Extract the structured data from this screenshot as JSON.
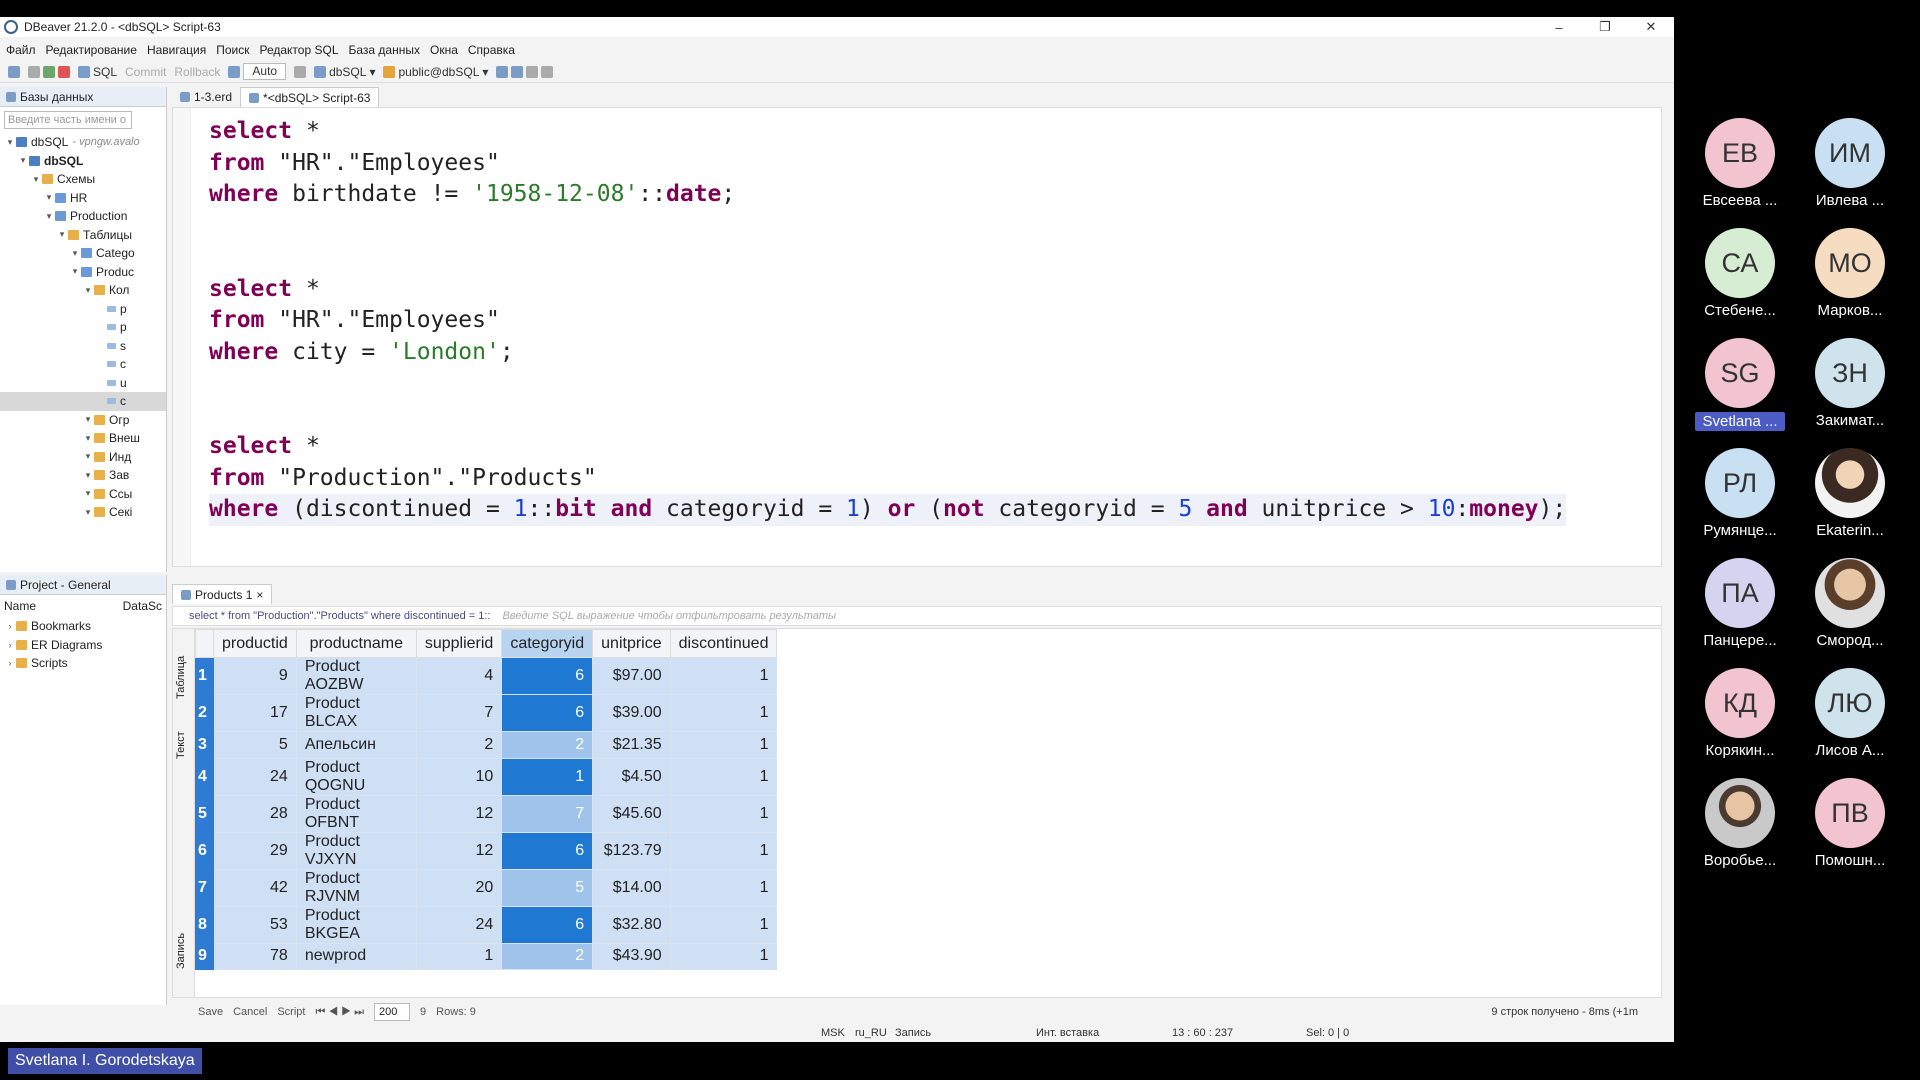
{
  "window": {
    "title": "DBeaver 21.2.0 - <dbSQL> Script-63"
  },
  "menu": [
    "Файл",
    "Редактирование",
    "Навигация",
    "Поиск",
    "Редактор SQL",
    "База данных",
    "Окна",
    "Справка"
  ],
  "toolbar": {
    "sql": "SQL",
    "commit": "Commit",
    "rollback": "Rollback",
    "mode": "Auto",
    "datasource": "dbSQL",
    "schema": "public@dbSQL"
  },
  "db_panel": {
    "title": "Базы данных",
    "filter_placeholder": "Введите часть имени о",
    "tree": [
      {
        "label": "dbSQL",
        "sub": "- vpngw.avalo",
        "level": 0,
        "type": "db"
      },
      {
        "label": "dbSQL",
        "level": 1,
        "type": "db",
        "bold": true
      },
      {
        "label": "Схемы",
        "level": 2,
        "type": "folder"
      },
      {
        "label": "HR",
        "level": 3,
        "type": "tb"
      },
      {
        "label": "Production",
        "level": 3,
        "type": "tb"
      },
      {
        "label": "Таблицы",
        "level": 4,
        "type": "folder"
      },
      {
        "label": "Catego",
        "level": 5,
        "type": "tb"
      },
      {
        "label": "Produc",
        "level": 5,
        "type": "tb"
      },
      {
        "label": "Кол",
        "level": 6,
        "type": "folder"
      },
      {
        "label": "p",
        "level": 7,
        "type": "cl"
      },
      {
        "label": "p",
        "level": 7,
        "type": "cl"
      },
      {
        "label": "s",
        "level": 7,
        "type": "cl"
      },
      {
        "label": "c",
        "level": 7,
        "type": "cl"
      },
      {
        "label": "u",
        "level": 7,
        "type": "cl"
      },
      {
        "label": "c",
        "level": 7,
        "type": "cl",
        "sel": true
      },
      {
        "label": "Огр",
        "level": 6,
        "type": "folder"
      },
      {
        "label": "Внеш",
        "level": 6,
        "type": "folder"
      },
      {
        "label": "Инд",
        "level": 6,
        "type": "folder"
      },
      {
        "label": "Зав",
        "level": 6,
        "type": "folder"
      },
      {
        "label": "Ссы",
        "level": 6,
        "type": "folder"
      },
      {
        "label": "Секі",
        "level": 6,
        "type": "folder"
      }
    ]
  },
  "project_panel": {
    "title": "Project - General",
    "col_name": "Name",
    "col_ds": "DataSc",
    "items": [
      "Bookmarks",
      "ER Diagrams",
      "Scripts"
    ]
  },
  "editor_tabs": [
    "1-3.erd",
    "*<dbSQL> Script-63"
  ],
  "code_lines": [
    [
      {
        "t": "select",
        "c": "kw"
      },
      {
        "t": " *",
        "c": "id"
      }
    ],
    [
      {
        "t": "from",
        "c": "kw"
      },
      {
        "t": " \"HR\".\"Employees\"",
        "c": "id"
      }
    ],
    [
      {
        "t": "where",
        "c": "kw"
      },
      {
        "t": " birthdate != ",
        "c": "id"
      },
      {
        "t": "'1958-12-08'",
        "c": "str"
      },
      {
        "t": "::",
        "c": "id"
      },
      {
        "t": "date",
        "c": "kw"
      },
      {
        "t": ";",
        "c": "id"
      }
    ],
    [],
    [],
    [
      {
        "t": "select",
        "c": "kw"
      },
      {
        "t": " *",
        "c": "id"
      }
    ],
    [
      {
        "t": "from",
        "c": "kw"
      },
      {
        "t": " \"HR\".\"Employees\"",
        "c": "id"
      }
    ],
    [
      {
        "t": "where",
        "c": "kw"
      },
      {
        "t": " city = ",
        "c": "id"
      },
      {
        "t": "'London'",
        "c": "str"
      },
      {
        "t": ";",
        "c": "id"
      }
    ],
    [],
    [],
    [
      {
        "t": "select",
        "c": "kw"
      },
      {
        "t": " *",
        "c": "id"
      }
    ],
    [
      {
        "t": "from",
        "c": "kw"
      },
      {
        "t": " \"Production\".\"Products\"",
        "c": "id"
      }
    ],
    [
      {
        "t": "where",
        "c": "kw"
      },
      {
        "t": " (discontinued = ",
        "c": "id"
      },
      {
        "t": "1",
        "c": "num"
      },
      {
        "t": "::",
        "c": "id"
      },
      {
        "t": "bit",
        "c": "kw"
      },
      {
        "t": " ",
        "c": "id"
      },
      {
        "t": "and",
        "c": "kw"
      },
      {
        "t": " categoryid = ",
        "c": "id"
      },
      {
        "t": "1",
        "c": "num"
      },
      {
        "t": ") ",
        "c": "id"
      },
      {
        "t": "or",
        "c": "kw"
      },
      {
        "t": " (",
        "c": "id"
      },
      {
        "t": "not",
        "c": "kw"
      },
      {
        "t": " categoryid = ",
        "c": "id"
      },
      {
        "t": "5",
        "c": "num"
      },
      {
        "t": " ",
        "c": "id"
      },
      {
        "t": "and",
        "c": "kw"
      },
      {
        "t": " unitprice > ",
        "c": "id"
      },
      {
        "t": "10",
        "c": "num"
      },
      {
        "t": ":",
        "c": "id"
      },
      {
        "t": "money",
        "c": "kw"
      },
      {
        "t": ");",
        "c": "id"
      }
    ]
  ],
  "results": {
    "tab": "Products 1",
    "query": "select * from \"Production\".\"Products\" where discontinued = 1::",
    "filter_placeholder": "Введите SQL выражение чтобы отфильтровать результаты",
    "side_tabs": [
      "Таблица",
      "Текст",
      "Запись"
    ],
    "columns": [
      "productid",
      "productname",
      "supplierid",
      "categoryid",
      "unitprice",
      "discontinued"
    ],
    "rows": [
      [
        "1",
        "9",
        "Product AOZBW",
        "4",
        "6",
        "$97.00",
        "1"
      ],
      [
        "2",
        "17",
        "Product BLCAX",
        "7",
        "6",
        "$39.00",
        "1"
      ],
      [
        "3",
        "5",
        "Апельсин",
        "2",
        "2",
        "$21.35",
        "1"
      ],
      [
        "4",
        "24",
        "Product QOGNU",
        "10",
        "1",
        "$4.50",
        "1"
      ],
      [
        "5",
        "28",
        "Product OFBNT",
        "12",
        "7",
        "$45.60",
        "1"
      ],
      [
        "6",
        "29",
        "Product VJXYN",
        "12",
        "6",
        "$123.79",
        "1"
      ],
      [
        "7",
        "42",
        "Product RJVNM",
        "20",
        "5",
        "$14.00",
        "1"
      ],
      [
        "8",
        "53",
        "Product BKGEA",
        "24",
        "6",
        "$32.80",
        "1"
      ],
      [
        "9",
        "78",
        "newprod",
        "1",
        "2",
        "$43.90",
        "1"
      ]
    ],
    "bottom": {
      "save": "Save",
      "cancel": "Cancel",
      "script": "Script",
      "fetch": "200",
      "count": "9",
      "rows": "Rows: 9",
      "fetched": "9 строк получено - 8ms (+1m"
    }
  },
  "status": {
    "tz": "MSK",
    "locale": "ru_RU",
    "mode": "Запись",
    "insert": "Инт. вставка",
    "pos": "13 : 60 : 237",
    "sel": "Sel: 0 | 0"
  },
  "participants": [
    {
      "initials": "ЕВ",
      "name": "Евсеева ...",
      "color": "#f2c4cf"
    },
    {
      "initials": "ИМ",
      "name": "Ивлева ...",
      "color": "#c9dff2"
    },
    {
      "initials": "СА",
      "name": "Стебене...",
      "color": "#d6ecd3"
    },
    {
      "initials": "МО",
      "name": "Марков...",
      "color": "#f6dcc0"
    },
    {
      "initials": "SG",
      "name": "Svetlana ...",
      "color": "#f2c4cf",
      "me": true
    },
    {
      "initials": "ЗН",
      "name": "Закимат...",
      "color": "#cfe3ec"
    },
    {
      "initials": "РЛ",
      "name": "Румянце...",
      "color": "#c9dff2"
    },
    {
      "initials": "",
      "name": "Ekaterin...",
      "photo": "photo2"
    },
    {
      "initials": "ПА",
      "name": "Панцере...",
      "color": "#d6d3f0"
    },
    {
      "initials": "",
      "name": "Смород...",
      "photo": "photo"
    },
    {
      "initials": "КД",
      "name": "Корякин...",
      "color": "#f2c4cf"
    },
    {
      "initials": "ЛЮ",
      "name": "Лисов А...",
      "color": "#cfe3ec"
    },
    {
      "initials": "",
      "name": "Воробье...",
      "photo": "photo3"
    },
    {
      "initials": "ПВ",
      "name": "Помошн...",
      "color": "#f2c4cf"
    }
  ],
  "speaker": "Svetlana I. Gorodetskaya"
}
